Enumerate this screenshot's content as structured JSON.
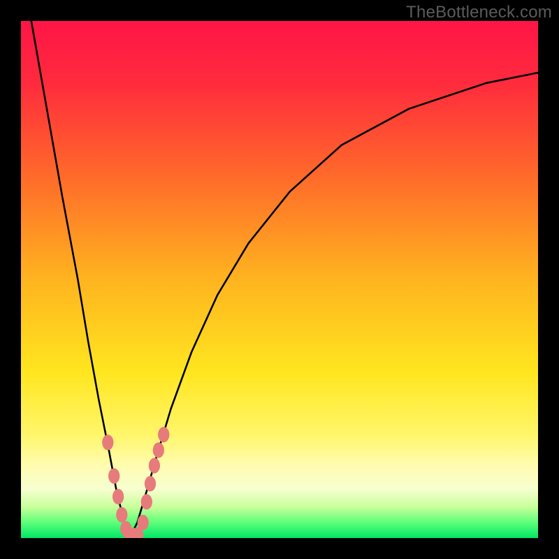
{
  "watermark": "TheBottleneck.com",
  "gradient_stops": [
    {
      "offset": 0,
      "color": "#ff1547"
    },
    {
      "offset": 0.12,
      "color": "#ff2b3d"
    },
    {
      "offset": 0.3,
      "color": "#ff6a2a"
    },
    {
      "offset": 0.5,
      "color": "#ffb41f"
    },
    {
      "offset": 0.68,
      "color": "#ffe61f"
    },
    {
      "offset": 0.8,
      "color": "#fff66a"
    },
    {
      "offset": 0.86,
      "color": "#fffcb0"
    },
    {
      "offset": 0.905,
      "color": "#f7ffd0"
    },
    {
      "offset": 0.94,
      "color": "#c8ff9a"
    },
    {
      "offset": 0.97,
      "color": "#5dff7a"
    },
    {
      "offset": 1.0,
      "color": "#00e765"
    }
  ],
  "chart_data": {
    "type": "line",
    "title": "",
    "xlabel": "",
    "ylabel": "",
    "xlim": [
      0,
      100
    ],
    "ylim": [
      0,
      100
    ],
    "note": "Values estimated from pixel positions; y=0 at bottom (green), y=100 at top (red). Curve touches 0 near x≈21.",
    "series": [
      {
        "name": "bottleneck-curve",
        "x": [
          2,
          5,
          8,
          11,
          13,
          15,
          17,
          18.5,
          20,
          21,
          22.5,
          24,
          26,
          29,
          33,
          38,
          44,
          52,
          62,
          75,
          90,
          100
        ],
        "y": [
          100,
          83,
          66,
          50,
          38,
          27,
          17,
          9,
          3,
          0,
          3,
          8,
          15,
          25,
          36,
          47,
          57,
          67,
          76,
          83,
          88,
          90
        ]
      }
    ],
    "markers": {
      "name": "highlighted-points",
      "color": "#e77b7b",
      "points": [
        {
          "x": 16.8,
          "y": 18.5
        },
        {
          "x": 18.0,
          "y": 12.0
        },
        {
          "x": 18.8,
          "y": 8.0
        },
        {
          "x": 19.5,
          "y": 4.5
        },
        {
          "x": 20.3,
          "y": 1.8
        },
        {
          "x": 21.0,
          "y": 0.5
        },
        {
          "x": 21.8,
          "y": 0.5
        },
        {
          "x": 22.6,
          "y": 0.6
        },
        {
          "x": 23.6,
          "y": 3.0
        },
        {
          "x": 24.3,
          "y": 7.0
        },
        {
          "x": 25.0,
          "y": 10.5
        },
        {
          "x": 25.8,
          "y": 14.0
        },
        {
          "x": 26.6,
          "y": 17.0
        },
        {
          "x": 27.6,
          "y": 20.0
        }
      ]
    }
  }
}
